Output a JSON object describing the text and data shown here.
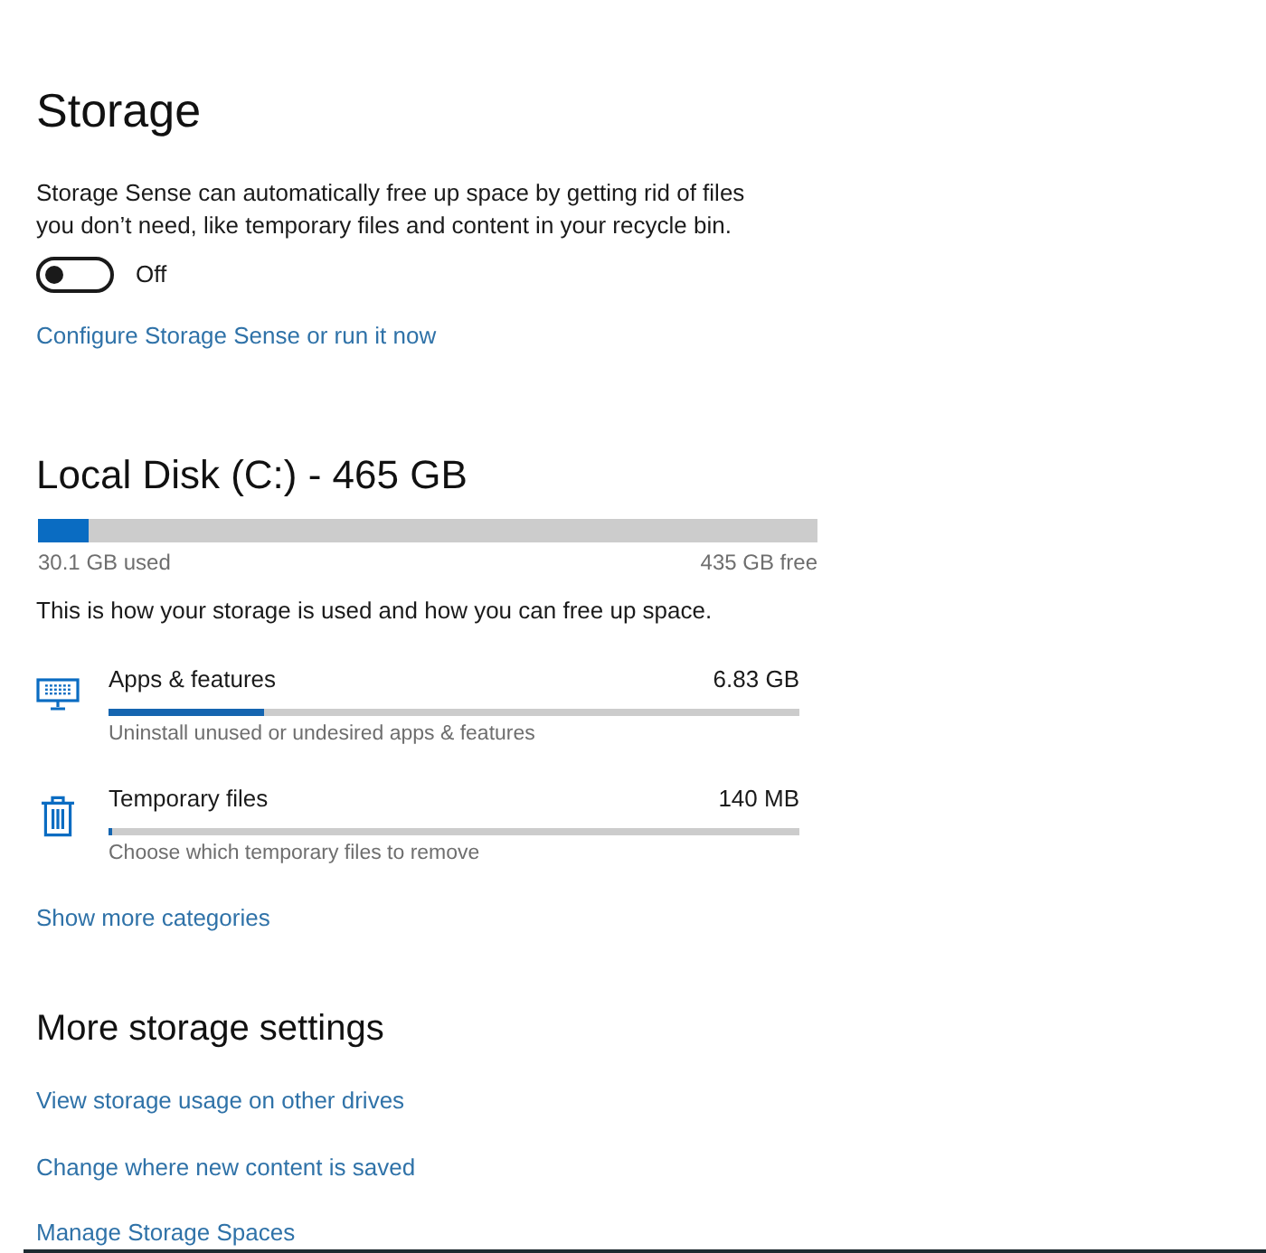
{
  "page": {
    "title": "Storage"
  },
  "storage_sense": {
    "description": "Storage Sense can automatically free up space by getting rid of files you don’t need, like temporary files and content in your recycle bin.",
    "toggle": {
      "on": false,
      "label": "Off"
    },
    "link": "Configure Storage Sense or run it now"
  },
  "disk": {
    "title": "Local Disk (C:) - 465 GB",
    "level": 0.065,
    "used": "30.1 GB used",
    "free": "435 GB free",
    "note": "This is how your storage is used and how you can free up space."
  },
  "categories": [
    {
      "kind": "apps",
      "name": "Apps & features",
      "size": "6.83 GB",
      "level": 0.225,
      "hint": "Uninstall unused or undesired apps & features"
    },
    {
      "kind": "temp",
      "name": "Temporary files",
      "size": "140 MB",
      "level": 0.005,
      "hint": "Choose which temporary files to remove"
    }
  ],
  "show_more": "Show more categories",
  "more_settings": {
    "title": "More storage settings",
    "links": [
      "View storage usage on other drives",
      "Change where new content is saved",
      "Manage Storage Spaces"
    ]
  }
}
